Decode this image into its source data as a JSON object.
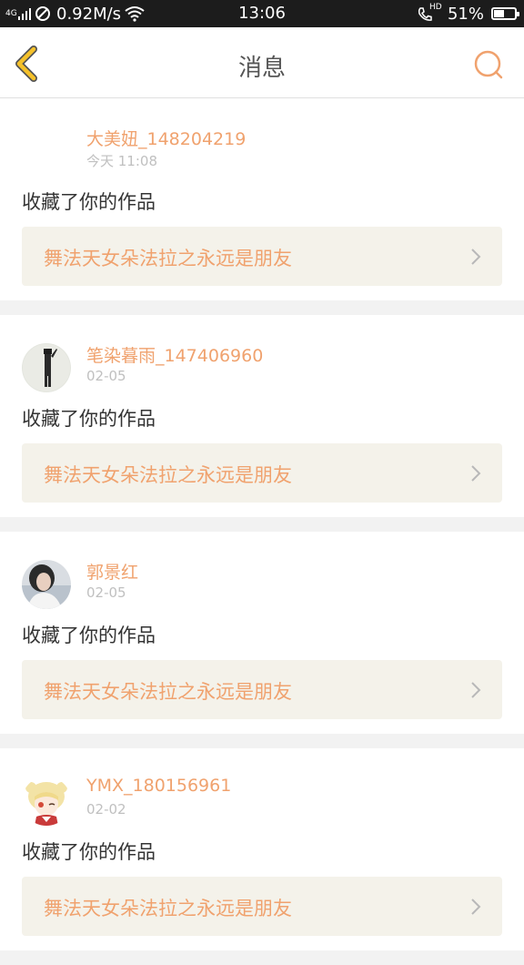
{
  "status_bar": {
    "network": "4G",
    "speed": "0.92M/s",
    "time": "13:06",
    "battery": "51%",
    "battery_level": 0.51,
    "hd_label": "HD"
  },
  "header": {
    "title": "消息",
    "back_icon": "chevron-left-icon",
    "search_icon": "search-icon"
  },
  "colors": {
    "accent": "#f0a26e",
    "back_arrow": "#f5c12a",
    "card_link_bg": "#f4f2ea"
  },
  "messages": [
    {
      "username": "大美妞_148204219",
      "time": "今天 11:08",
      "action": "收藏了你的作品",
      "work_title": "舞法天女朵法拉之永远是朋友",
      "avatar": "none"
    },
    {
      "username": "笔染暮雨_147406960",
      "time": "02-05",
      "action": "收藏了你的作品",
      "work_title": "舞法天女朵法拉之永远是朋友",
      "avatar": "figure-on-pale-background"
    },
    {
      "username": "郭景红",
      "time": "02-05",
      "action": "收藏了你的作品",
      "work_title": "舞法天女朵法拉之永远是朋友",
      "avatar": "woman-portrait"
    },
    {
      "username": "YMX_180156961",
      "time": "02-02",
      "action": "收藏了你的作品",
      "work_title": "舞法天女朵法拉之永远是朋友",
      "avatar": "anime-girl"
    }
  ]
}
